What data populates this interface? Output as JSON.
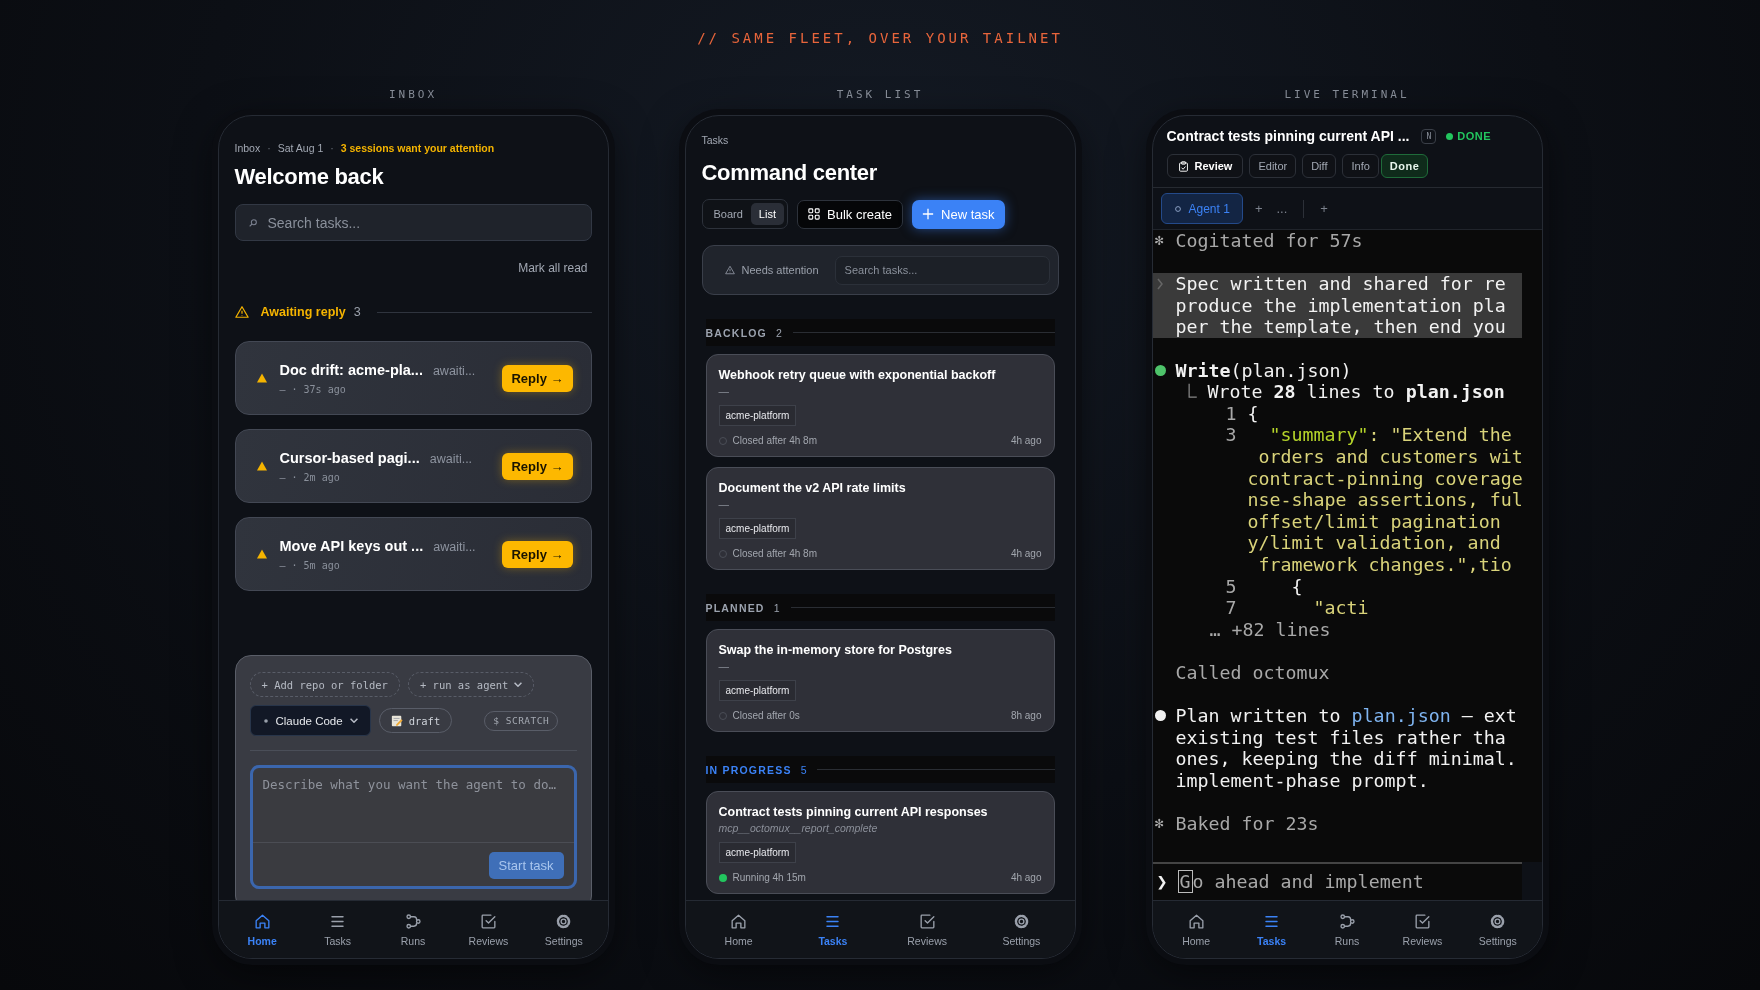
{
  "heading": "// SAME FLEET, OVER YOUR TAILNET",
  "inbox": {
    "label": "INBOX",
    "crumbs": [
      {
        "text": "Inbox",
        "highlight": false
      },
      {
        "text": "Sat Aug 1",
        "highlight": false
      },
      {
        "text": "3 sessions want your attention",
        "highlight": true
      }
    ],
    "separator": "·",
    "title": "Welcome back",
    "search": {
      "placeholder": "Search tasks..."
    },
    "mark_all_read": "Mark all read",
    "section": {
      "title": "Awaiting reply",
      "count": "3"
    },
    "items": [
      {
        "title": "Doc drift: acme-pla...",
        "status": "awaiti...",
        "meta": "— · 37s ago",
        "action": "Reply →"
      },
      {
        "title": "Cursor-based pagi...",
        "status": "awaiti...",
        "meta": "— · 2m ago",
        "action": "Reply →"
      },
      {
        "title": "Move API keys out ...",
        "status": "awaiti...",
        "meta": "— · 5m ago",
        "action": "Reply →"
      }
    ],
    "composer": {
      "chips": [
        {
          "kind": "dashed",
          "label": "+ Add repo or folder",
          "caret": false
        },
        {
          "kind": "dashed",
          "label": "+ run as agent",
          "caret": true
        },
        {
          "kind": "agent",
          "label": "Claude Code",
          "caret": true
        },
        {
          "kind": "draft",
          "label": "draft",
          "caret": false
        },
        {
          "kind": "badge",
          "label": "$ SCRATCH",
          "caret": false
        }
      ],
      "placeholder": "Describe what you want the agent to do…",
      "submit": "Start task"
    },
    "nav": [
      {
        "kind": "home",
        "label": "Home",
        "selected": true
      },
      {
        "kind": "tasks",
        "label": "Tasks",
        "selected": false
      },
      {
        "kind": "runs",
        "label": "Runs",
        "selected": false
      },
      {
        "kind": "reviews",
        "label": "Reviews",
        "selected": false
      },
      {
        "kind": "settings",
        "label": "Settings",
        "selected": false
      }
    ]
  },
  "task_list": {
    "label": "TASK LIST",
    "crumb": "Tasks",
    "title": "Command center",
    "views": [
      {
        "label": "Board",
        "selected": false
      },
      {
        "label": "List",
        "selected": true
      }
    ],
    "bulk": "Bulk create",
    "new_task": "New task",
    "filter": "Needs attention",
    "search": {
      "placeholder": "Search tasks..."
    },
    "groups": [
      {
        "name": "BACKLOG",
        "count": "2",
        "color": "#9ca3af",
        "tasks": [
          {
            "title": "Webhook retry queue with exponential backoff",
            "note": "—",
            "tag": "acme-platform",
            "kind": "closed",
            "status": "Closed after 4h 8m",
            "age": "4h ago"
          },
          {
            "title": "Document the v2 API rate limits",
            "note": "—",
            "tag": "acme-platform",
            "kind": "closed",
            "status": "Closed after 4h 8m",
            "age": "4h ago"
          }
        ]
      },
      {
        "name": "PLANNED",
        "count": "1",
        "color": "#9ca3af",
        "tasks": [
          {
            "title": "Swap the in-memory store for Postgres",
            "note": "—",
            "tag": "acme-platform",
            "kind": "closed",
            "status": "Closed after 0s",
            "age": "8h ago"
          }
        ]
      },
      {
        "name": "IN PROGRESS",
        "count": "5",
        "color": "#3b82f6",
        "tasks": [
          {
            "title": "Contract tests pinning current API responses",
            "note": "mcp__octomux__report_complete",
            "tag": "acme-platform",
            "kind": "running",
            "status": "Running 4h 15m",
            "age": "4h ago"
          }
        ]
      }
    ],
    "nav": [
      {
        "kind": "home",
        "label": "Home",
        "selected": false
      },
      {
        "kind": "tasks",
        "label": "Tasks",
        "selected": true
      },
      {
        "kind": "reviews",
        "label": "Reviews",
        "selected": false
      },
      {
        "kind": "settings",
        "label": "Settings",
        "selected": false
      }
    ]
  },
  "live_terminal": {
    "label": "LIVE TERMINAL",
    "title": "Contract tests pinning current API ...",
    "badge": "N",
    "status": "DONE",
    "actions": [
      {
        "label": "Review",
        "kind": "review"
      },
      {
        "label": "Editor",
        "kind": "plain"
      },
      {
        "label": "Diff",
        "kind": "plain"
      },
      {
        "label": "Info",
        "kind": "plain"
      },
      {
        "label": "Done",
        "kind": "done"
      }
    ],
    "agents": [
      {
        "label": "Agent 1",
        "selected": true
      }
    ],
    "tab_controls": [
      "+",
      "..."
    ],
    "add_tab": "+",
    "blocks": [
      {
        "kind": "status",
        "mark": "✻",
        "text": "Cogitated for 57s"
      },
      {
        "kind": "prompt",
        "lines": [
          "Spec written and shared for re",
          "produce the implementation pla",
          "per the template, then end you"
        ]
      },
      {
        "kind": "tool",
        "text": "**Write**(plan.json)",
        "result": "Wrote **28** lines to **plan.json**",
        "code": [
          {
            "number": "1",
            "text": "{",
            "kind": "plain"
          },
          {
            "number": "3",
            "key": "  \"summary\"",
            "text": ": \"Extend the",
            "kind": "string"
          },
          {
            "text": " orders and customers wit",
            "kind": "string"
          },
          {
            "text": "contract-pinning coverage",
            "kind": "string"
          },
          {
            "text": "nse-shape assertions, ful",
            "kind": "string"
          },
          {
            "text": "offset/limit pagination",
            "kind": "string"
          },
          {
            "text": "y/limit validation, and",
            "kind": "string"
          },
          {
            "text": " framework changes.\",tio",
            "kind": "string"
          },
          {
            "number": "5",
            "text": "    {",
            "kind": "plain"
          },
          {
            "number": "7",
            "text": "      \"acti",
            "kind": "string"
          }
        ],
        "more": "… +82 lines"
      },
      {
        "kind": "note",
        "text": "Called octomux"
      },
      {
        "kind": "message",
        "before": "Plan written to ",
        "link": "plan.json",
        "after": " — ext",
        "lines": [
          "existing test files rather tha",
          "ones, keeping the diff minimal.",
          "implement-phase prompt."
        ]
      },
      {
        "kind": "status",
        "mark": "✻",
        "text": "Baked for 23s"
      }
    ],
    "input": {
      "prompt": "❯",
      "value": "Go ahead and implement"
    },
    "nav": [
      {
        "kind": "home",
        "label": "Home",
        "selected": false
      },
      {
        "kind": "tasks",
        "label": "Tasks",
        "selected": true
      },
      {
        "kind": "runs",
        "label": "Runs",
        "selected": false
      },
      {
        "kind": "reviews",
        "label": "Reviews",
        "selected": false
      },
      {
        "kind": "settings",
        "label": "Settings",
        "selected": false
      }
    ]
  }
}
